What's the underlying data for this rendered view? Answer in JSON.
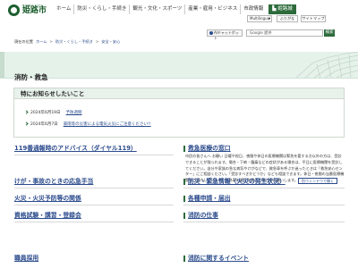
{
  "header": {
    "logo_sub": "HIMEJI CITY",
    "logo_main": "姫路市",
    "nav": [
      {
        "label": "ホーム"
      },
      {
        "label": "防災・くらし・手続き"
      },
      {
        "label": "観光・文化・スポーツ"
      },
      {
        "label": "産業・雇用・ビジネス"
      },
      {
        "label": "市政情報"
      }
    ],
    "castle_label": "姫路城",
    "language_select": "Multilingual",
    "furigana_button": "ふりがな",
    "sitemap_button": "サイトマップ"
  },
  "breadcrumb": [
    "現在の位置",
    "ホーム",
    "防災・くらし・手続き",
    "安全・安心"
  ],
  "ai_button_label": "AIチャットボット",
  "search": {
    "value": "Google 提供",
    "button": "検索"
  },
  "page_title": "消防・救急",
  "notices": {
    "heading": "特にお知らせしたいこと",
    "items": [
      {
        "date": "2024年6月19日",
        "text": "予防週間"
      },
      {
        "date": "2024年6月7日",
        "text": "豪雨等の災害による電気火災にご注意ください!!"
      }
    ]
  },
  "sections_left": [
    {
      "title": "119番通報時のアドバイス（ダイヤル119）"
    },
    {
      "title": "けが・事故のときの応急手当"
    },
    {
      "title": "火災・火災予防等の関係"
    },
    {
      "title": "資格試験・講習・登録会"
    },
    {
      "title": "職員採用"
    }
  ],
  "sections_right": [
    {
      "title": "救急医療の窓口"
    },
    {
      "title": "防災・緊急情報（火災の発生状況）"
    },
    {
      "title": "各種申請・届出"
    },
    {
      "title": "消防の仕事"
    },
    {
      "title": "消防に関するイベント"
    }
  ],
  "emergency_text": "市民の皆さんへ お願い 日曜や祝日、夜間や休日の医療機関は緊急を要する方以外の方は、受診できることが限られます。場合・下痢・腹痛などの症状がある場合は、平日に医療機関を受診してください。自分や家族の急な病気やけがなどで、救急車を呼ぶか迷ったときは「救急安心センター」にご相談ください。「受診すべきかどうか」なども相談できます。休日・夜間の当番医療機関もご案内しています。救急車の適正利用にご協力をお願いします。",
  "badge_label": "別ウィンドウで開く",
  "colors": {
    "brand_green": "#2d6b3b",
    "link_blue": "#2b4b8c",
    "band_green": "#e5f2ea"
  }
}
